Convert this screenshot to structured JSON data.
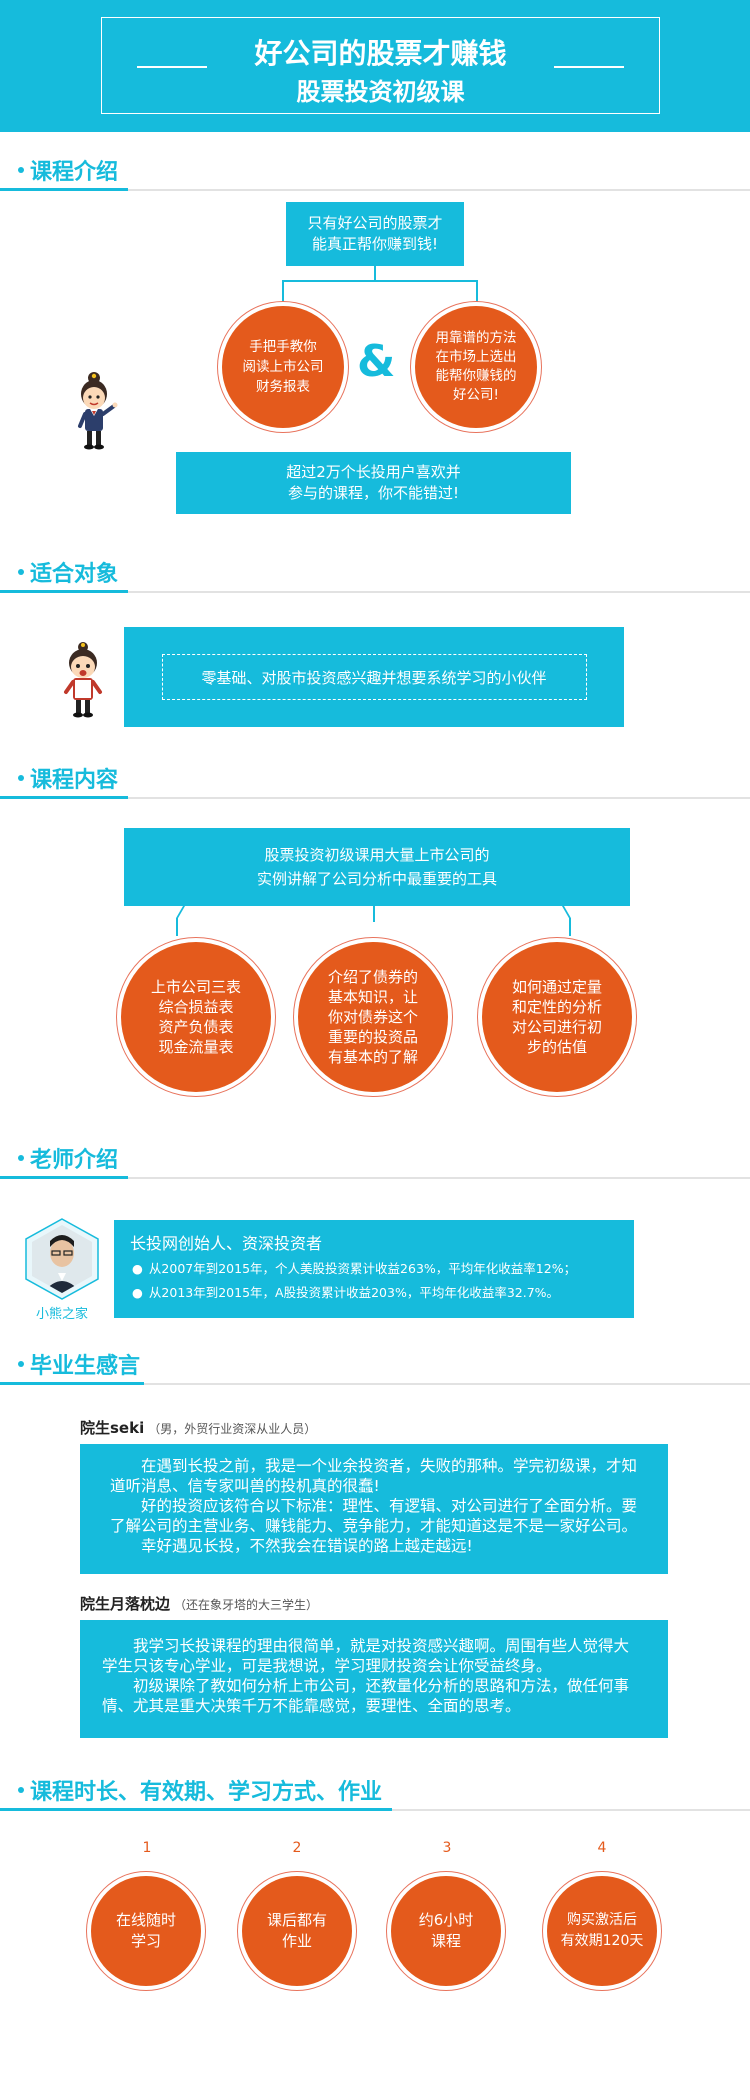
{
  "header": {
    "title": "好公司的股票才赚钱",
    "subtitle": "股票投资初级课"
  },
  "sections": {
    "intro": "课程介绍",
    "audience": "适合对象",
    "content": "课程内容",
    "teacher": "老师介绍",
    "graduates": "毕业生感言",
    "duration": "课程时长、有效期、学习方式、作业"
  },
  "intro": {
    "top_box": [
      "只有好公司的股票才",
      "能真正帮你赚到钱!"
    ],
    "left_circle": [
      "手把手教你",
      "阅读上市公司",
      "财务报表"
    ],
    "ampersand": "&",
    "right_circle": [
      "用靠谱的方法",
      "在市场上选出",
      "能帮你赚钱的",
      "好公司!"
    ],
    "bottom_box": [
      "超过2万个长投用户喜欢并",
      "参与的课程，你不能错过!"
    ]
  },
  "audience": {
    "text": "零基础、对股市投资感兴趣并想要系统学习的小伙伴"
  },
  "content": {
    "top_box": [
      "股票投资初级课用大量上市公司的",
      "实例讲解了公司分析中最重要的工具"
    ],
    "circles": [
      [
        "上市公司三表",
        "综合损益表",
        "资产负债表",
        "现金流量表"
      ],
      [
        "介绍了债券的",
        "基本知识，让",
        "你对债券这个",
        "重要的投资品",
        "有基本的了解"
      ],
      [
        "如何通过定量",
        "和定性的分析",
        "对公司进行初",
        "步的估值"
      ]
    ]
  },
  "teacher": {
    "name": "小熊之家",
    "headline": "长投网创始人、资深投资者",
    "bullets": [
      "从2007年到2015年，个人美股投资累计收益263%，平均年化收益率12%；",
      "从2013年到2015年，A股投资累计收益203%，平均年化收益率32.7%。"
    ]
  },
  "graduates": [
    {
      "name": "院生seki",
      "meta": "（男，外贸行业资深从业人员）",
      "paragraphs": [
        "在遇到长投之前，我是一个业余投资者，失败的那种。学完初级课，才知道听消息、信专家叫兽的投机真的很蠢!",
        "好的投资应该符合以下标准：理性、有逻辑、对公司进行了全面分析。要了解公司的主营业务、赚钱能力、竞争能力，才能知道这是不是一家好公司。",
        "幸好遇见长投，不然我会在错误的路上越走越远!"
      ]
    },
    {
      "name": "院生月落枕边",
      "meta": "（还在象牙塔的大三学生）",
      "paragraphs": [
        "我学习长投课程的理由很简单，就是对投资感兴趣啊。周围有些人觉得大学生只该专心学业，可是我想说，学习理财投资会让你受益终身。",
        "初级课除了教如何分析上市公司，还教量化分析的思路和方法，做任何事情、尤其是重大决策千万不能靠感觉，要理性、全面的思考。"
      ]
    }
  ],
  "duration": {
    "items": [
      {
        "num": "1",
        "lines": [
          "在线随时",
          "学习"
        ]
      },
      {
        "num": "2",
        "lines": [
          "课后都有",
          "作业"
        ]
      },
      {
        "num": "3",
        "lines": [
          "约6小时",
          "课程"
        ]
      },
      {
        "num": "4",
        "lines": [
          "购买激活后",
          "有效期120天"
        ]
      }
    ]
  },
  "colors": {
    "cyan": "#16bbdc",
    "orange": "#e45a1c"
  }
}
